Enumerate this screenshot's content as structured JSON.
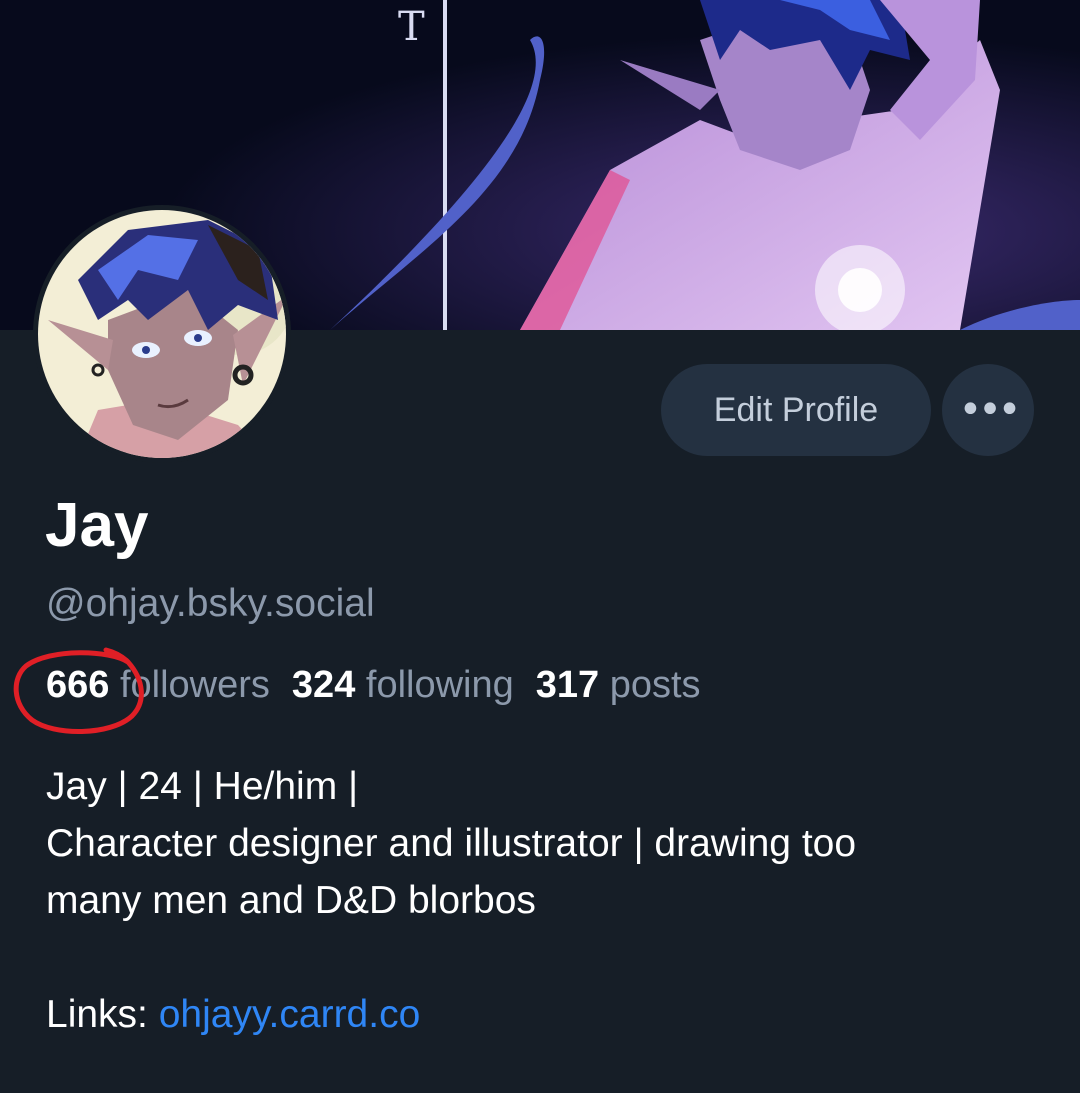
{
  "profile": {
    "display_name": "Jay",
    "handle": "@ohjay.bsky.social"
  },
  "actions": {
    "edit_label": "Edit Profile",
    "more_label": "•••"
  },
  "stats": {
    "followers_count": "666",
    "followers_label": "followers",
    "following_count": "324",
    "following_label": "following",
    "posts_count": "317",
    "posts_label": "posts"
  },
  "bio": {
    "line1": "Jay | 24 | He/him |",
    "line2": "Character designer and illustrator | drawing too",
    "line3": "many men and D&D blorbos",
    "links_label": "Links: ",
    "link_text": "ohjayy.carrd.co"
  },
  "colors": {
    "background": "#161e27",
    "button_bg": "#243141",
    "link": "#2f86f5",
    "muted_text": "#8c99ab",
    "annotation_circle": "#e01f26"
  }
}
